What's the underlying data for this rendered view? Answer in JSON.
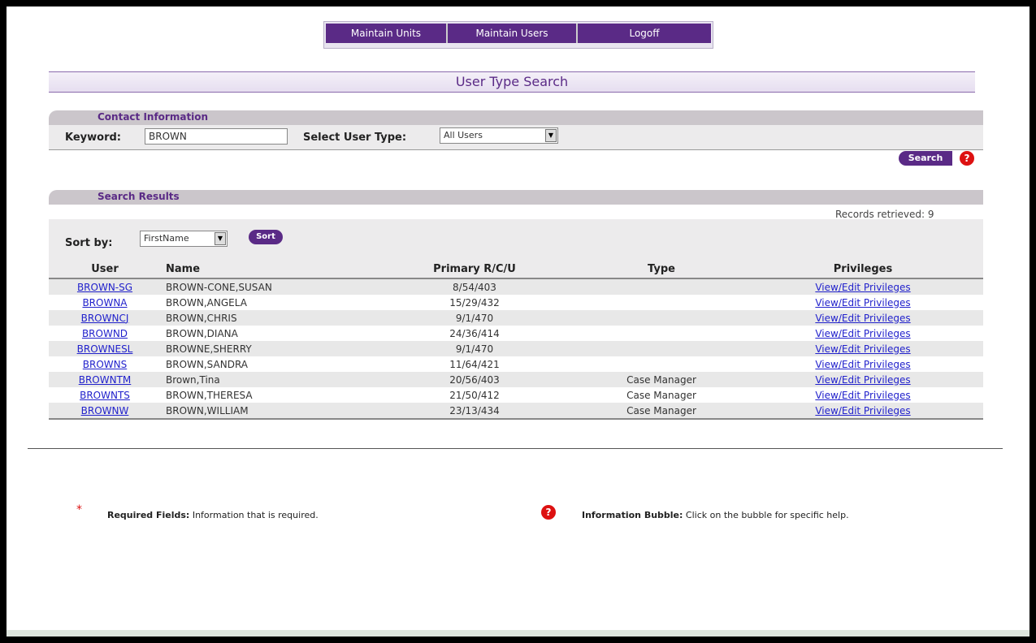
{
  "nav": {
    "maintain_units": "Maintain Units",
    "maintain_users": "Maintain Users",
    "logoff": "Logoff"
  },
  "page_title": "User Type Search",
  "contact": {
    "section_title": "Contact Information",
    "keyword_label": "Keyword:",
    "keyword_value": "BROWN",
    "user_type_label": "Select User Type:",
    "user_type_value": "All Users"
  },
  "search_button": "Search",
  "help_glyph": "?",
  "results": {
    "section_title": "Search Results",
    "records_text": "Records retrieved: 9",
    "sort_label": "Sort by:",
    "sort_value": "FirstName",
    "sort_button": "Sort",
    "columns": [
      "User",
      "Name",
      "Primary R/C/U",
      "Type",
      "Privileges"
    ],
    "rows": [
      {
        "user": "BROWN-SG",
        "name": "BROWN-CONE,SUSAN",
        "primary": "8/54/403",
        "type": "",
        "privileges": "View/Edit Privileges"
      },
      {
        "user": "BROWNA",
        "name": "BROWN,ANGELA",
        "primary": "15/29/432",
        "type": "",
        "privileges": "View/Edit Privileges"
      },
      {
        "user": "BROWNCJ",
        "name": "BROWN,CHRIS",
        "primary": "9/1/470",
        "type": "",
        "privileges": "View/Edit Privileges"
      },
      {
        "user": "BROWND",
        "name": "BROWN,DIANA",
        "primary": "24/36/414",
        "type": "",
        "privileges": "View/Edit Privileges"
      },
      {
        "user": "BROWNESL",
        "name": "BROWNE,SHERRY",
        "primary": "9/1/470",
        "type": "",
        "privileges": "View/Edit Privileges"
      },
      {
        "user": "BROWNS",
        "name": "BROWN,SANDRA",
        "primary": "11/64/421",
        "type": "",
        "privileges": "View/Edit Privileges"
      },
      {
        "user": "BROWNTM",
        "name": "Brown,Tina",
        "primary": "20/56/403",
        "type": "Case Manager",
        "privileges": "View/Edit Privileges"
      },
      {
        "user": "BROWNTS",
        "name": "BROWN,THERESA",
        "primary": "21/50/412",
        "type": "Case Manager",
        "privileges": "View/Edit Privileges"
      },
      {
        "user": "BROWNW",
        "name": "BROWN,WILLIAM",
        "primary": "23/13/434",
        "type": "Case Manager",
        "privileges": "View/Edit Privileges"
      }
    ]
  },
  "legend": {
    "required_star": "*",
    "required_label": "Required Fields:",
    "required_desc": "Information that is required.",
    "bubble_label": "Information Bubble:",
    "bubble_desc": "Click on the bubble for specific help."
  },
  "colors": {
    "brand_purple": "#5a2a86",
    "link_blue": "#2222cc",
    "help_red": "#dd1111"
  }
}
